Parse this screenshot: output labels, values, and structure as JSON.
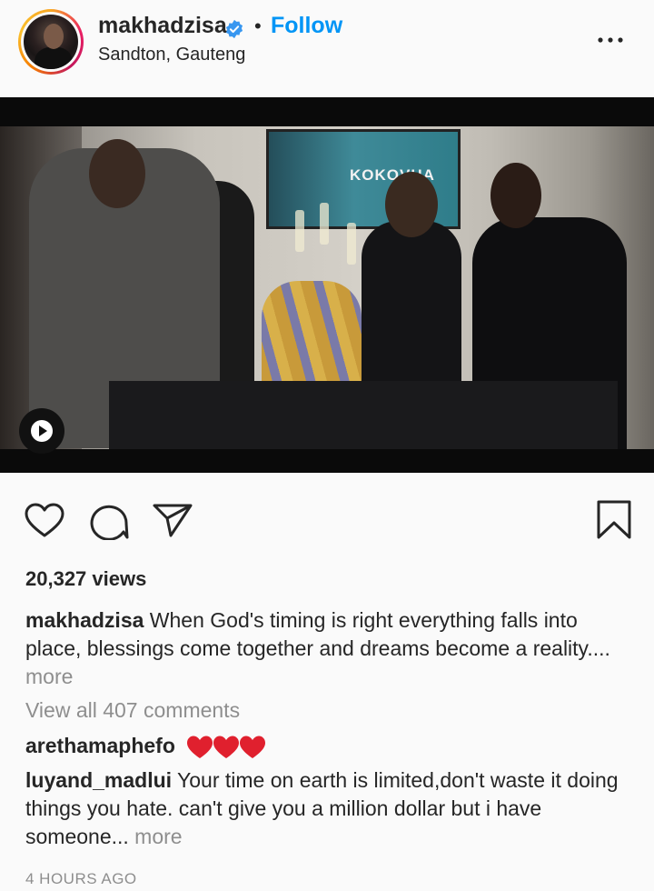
{
  "post_header": {
    "username": "makhadzisa",
    "verified_icon": "verified-badge-icon",
    "separator": "•",
    "follow_label": "Follow",
    "location": "Sandton, Gauteng",
    "more_icon": "more-options-icon"
  },
  "media": {
    "screen_text": "KOKOVHA",
    "media_type_icon": "video-play-icon"
  },
  "actions": {
    "like_icon": "heart-icon",
    "comment_icon": "comment-icon",
    "share_icon": "send-icon",
    "save_icon": "bookmark-icon"
  },
  "stats": {
    "views": "20,327 views"
  },
  "caption": {
    "username": "makhadzisa",
    "text": " When God's timing is right everything falls into place, blessings come together and dreams become a reality....",
    "more_label": " more"
  },
  "comments": {
    "view_all_label": "View all 407 comments",
    "items": [
      {
        "username": "arethamaphefo",
        "text": "",
        "emoji": "❤❤❤"
      },
      {
        "username": "luyand_madlui",
        "text": " Your time on earth is limited,don't waste it doing things you hate. can't give you a million dollar but i have someone...",
        "more_label": " more"
      }
    ]
  },
  "timestamp": "4 HOURS AGO",
  "colors": {
    "accent": "#0095f6",
    "text": "#262626",
    "muted": "#8e8e8e",
    "background": "#fafafa",
    "heart": "#e0202e"
  }
}
